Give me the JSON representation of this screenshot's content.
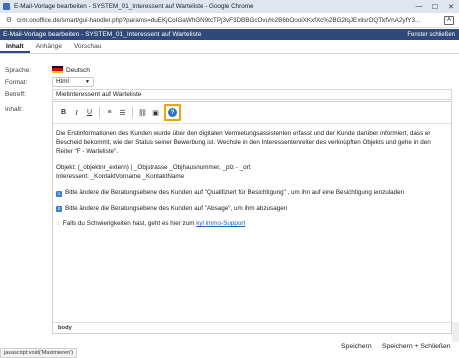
{
  "window": {
    "title": "E-Mail-Vorlage bearbeiten - SYSTEM_01_Interessent auf Warteliste - Google Chrome",
    "controls": {
      "minimize": "—",
      "maximize": "☐",
      "close": "✕"
    }
  },
  "address": {
    "url": "crm.onoffice.de/smart/gui-handler.php?params=duEKjCoIGaWhGN9tcTPj3vF3DBBGcOvu%2B6bOoolXKxfXc%2BG2lqJExllsrOQTkfVnA2yfY3..."
  },
  "dialog": {
    "title": "E-Mail-Vorlage bearbeiten - SYSTEM_01_Interessent auf Warteliste",
    "close_label": "Fenster schließen"
  },
  "tabs": [
    {
      "label": "Inhalt",
      "active": true
    },
    {
      "label": "Anhänge",
      "active": false
    },
    {
      "label": "Vorschau",
      "active": false
    }
  ],
  "form": {
    "language_label": "Sprache:",
    "language_value": "Deutsch",
    "format_label": "Format:",
    "format_value": "Html",
    "subject_label": "Betreff:",
    "subject_value": "Mietinteressent auf Warteliste",
    "content_label": "Inhalt:"
  },
  "toolbar": {
    "bold": "B",
    "italic": "I",
    "underline": "U",
    "ordered_list": "≡",
    "unordered_list": "☰",
    "link": "⛓",
    "image": "▣",
    "help": "?"
  },
  "editor": {
    "paragraph1": "Die Erstinformationen des Kunden wurde über den digitalen Vermietungsassistenten erfasst und der Kunde darüber informiert, dass er Bescheid bekommt, wie der Status seiner Bewerbung ist. Wechsle in den Interessentenreiter des verknüpften Objekts und gehe in den Reiter \"F - Warteliste\".",
    "objekt_line": "Objekt: (_objektnr_extern) | _Objstrasse _Objhausnummer, _plz - _ort",
    "interessent_line": "Interessent: _KontaktVorname _KontaktName",
    "step1_num": "1",
    "step1_text": "Bitte ändere die Beratungsebene des Kunden auf \"Qualifiziert für Besichtigung\" , um ihn auf eine Besichtigung einzuladen",
    "step2_num": "2",
    "step2_text": "Bitte ändere die Beratungsebene des Kunden auf \"Absage\", um ihm abzusagen",
    "hint_icon": "☝",
    "hint_text": "Falls du Schwierigkeiten hast, geht es hier zum",
    "hint_link": "kyl immo-Support",
    "status_tag": "body"
  },
  "footer": {
    "save_label": "Speichern",
    "save_close_label": "Speichern + Schließen",
    "js_status": "javascript:void('Maximieren')"
  }
}
